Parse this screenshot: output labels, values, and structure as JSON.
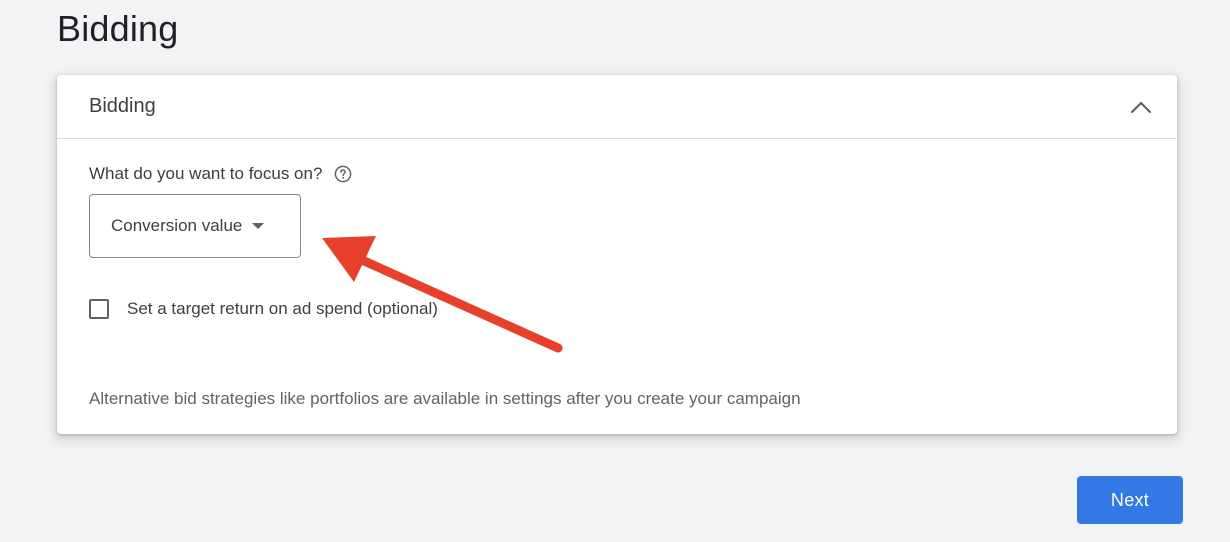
{
  "page": {
    "title": "Bidding"
  },
  "card": {
    "header_title": "Bidding",
    "collapse_icon": "chevron-up-icon",
    "focus_question": "What do you want to focus on?",
    "help_icon": "help-circle-icon",
    "focus_select": {
      "selected": "Conversion value"
    },
    "target_roas": {
      "label": "Set a target return on ad spend (optional)",
      "checked": false
    },
    "footnote": "Alternative bid strategies like portfolios are available in settings after you create your campaign"
  },
  "annotation": {
    "color": "#e8412b",
    "shape": "arrow"
  },
  "actions": {
    "next_label": "Next",
    "next_color": "#3478e5"
  }
}
